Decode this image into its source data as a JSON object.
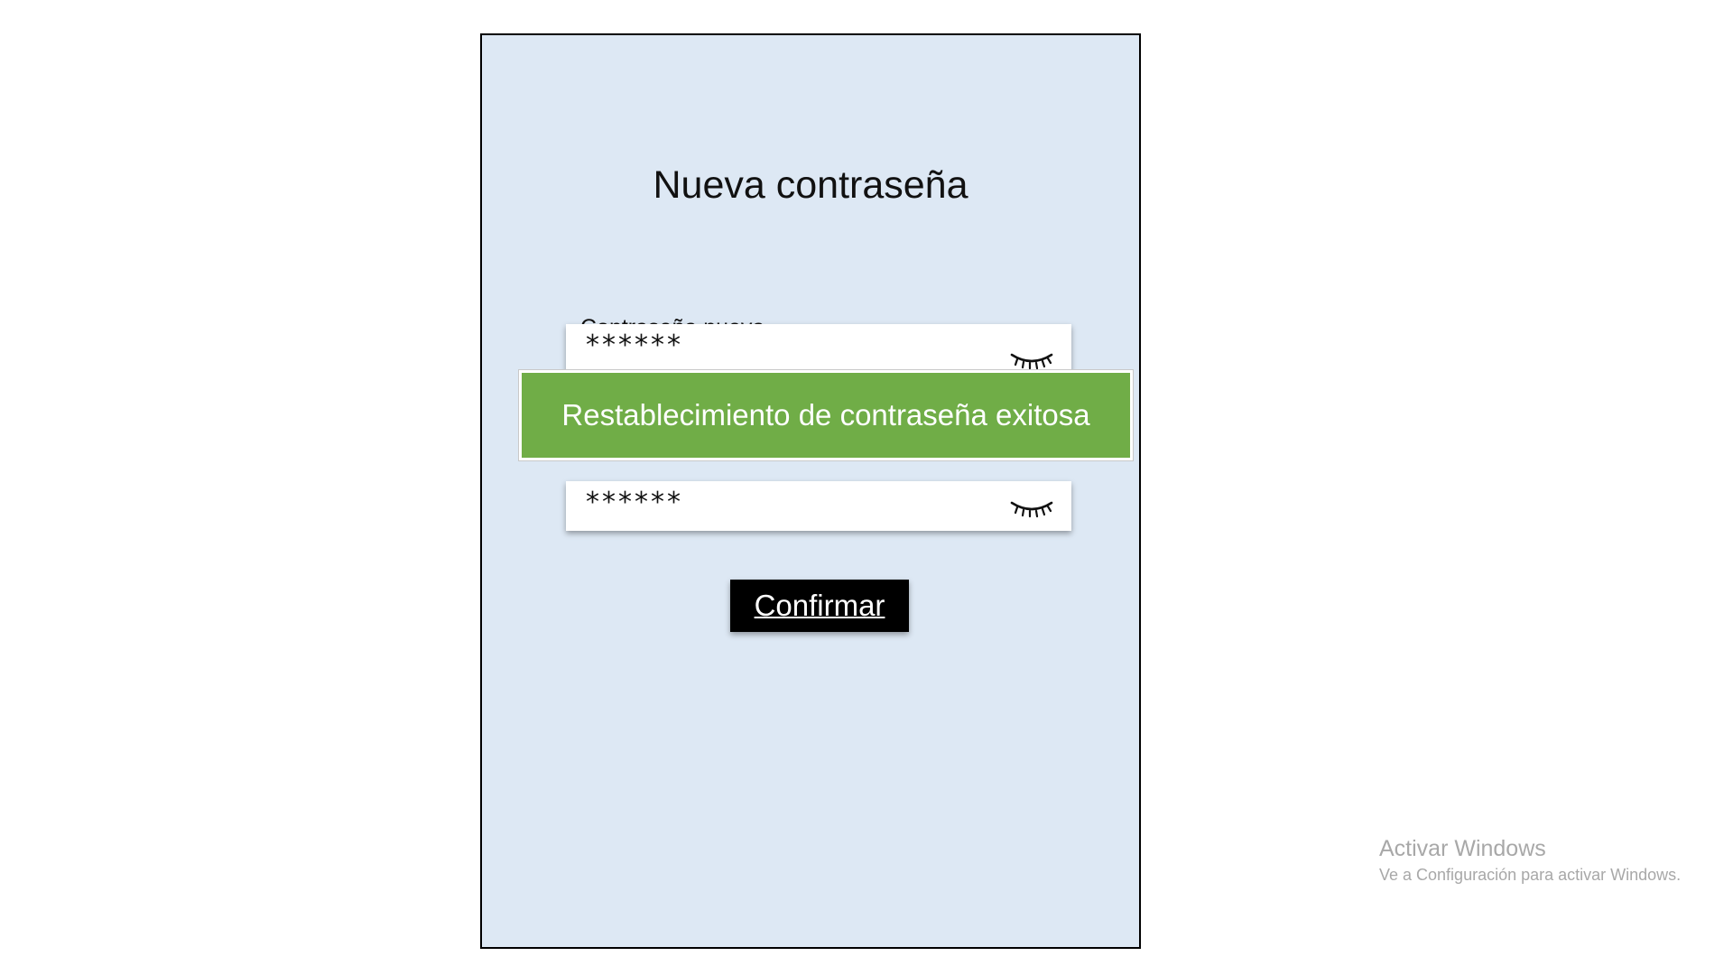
{
  "form": {
    "title": "Nueva contraseña",
    "new_password_label": "Contraseña nueva",
    "new_password_value": "******",
    "confirm_password_value": "******",
    "confirm_button": "Confirmar",
    "eye_icon": "eye-closed-icon"
  },
  "toast": {
    "message": "Restablecimiento de contraseña exitosa",
    "color": "#70ad47"
  },
  "watermark": {
    "title": "Activar Windows",
    "subtitle": "Ve a Configuración para activar Windows."
  }
}
